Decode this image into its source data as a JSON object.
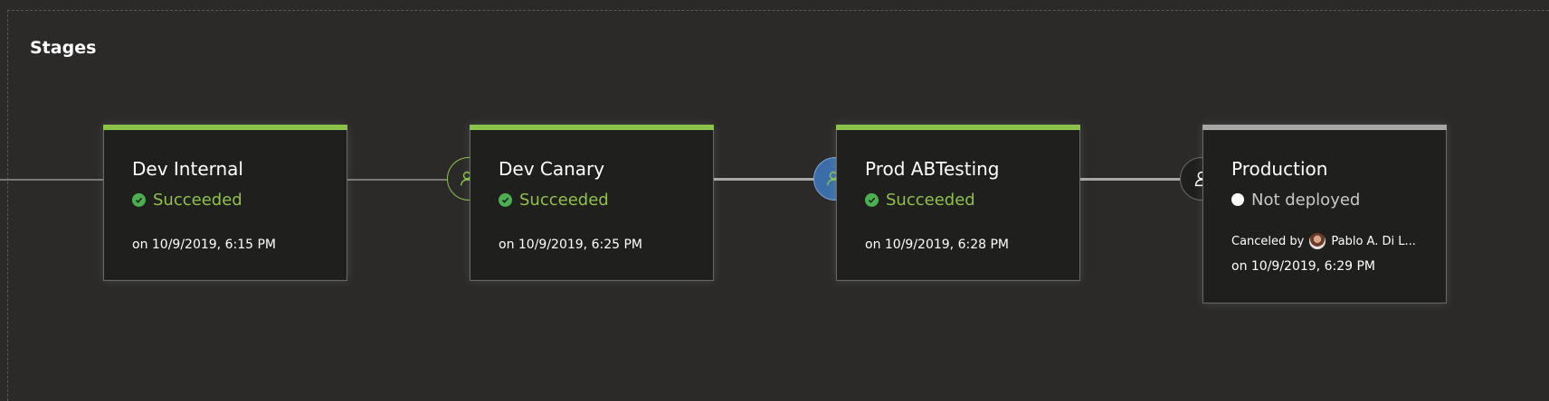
{
  "section_title": "Stages",
  "stages": [
    {
      "name": "Dev Internal",
      "status": "Succeeded",
      "status_color": "#8fc14b",
      "bar_color": "#8bc34a",
      "date": "on 10/9/2019, 6:15 PM"
    },
    {
      "name": "Dev Canary",
      "status": "Succeeded",
      "status_color": "#8fc14b",
      "bar_color": "#8bc34a",
      "date": "on 10/9/2019, 6:25 PM",
      "gate_icon": "user-check-icon"
    },
    {
      "name": "Prod ABTesting",
      "status": "Succeeded",
      "status_color": "#8fc14b",
      "bar_color": "#8bc34a",
      "date": "on 10/9/2019, 6:28 PM",
      "gate_icon": "user-check-icon"
    },
    {
      "name": "Production",
      "status": "Not deployed",
      "status_color": "#c8c8c8",
      "bar_color": "#a6a6a6",
      "canceled_label": "Canceled by",
      "canceled_user": "Pablo A. Di L...",
      "date": "on 10/9/2019, 6:29 PM",
      "gate_icon": "user-icon"
    }
  ]
}
